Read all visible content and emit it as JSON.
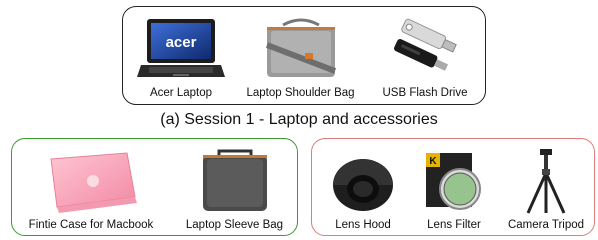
{
  "session1": {
    "caption": "(a) Session 1 - Laptop and accessories",
    "items": [
      {
        "label": "Acer Laptop",
        "logo_text": "acer",
        "icon": "laptop-image"
      },
      {
        "label": "Laptop Shoulder Bag",
        "icon": "shoulder-bag-image"
      },
      {
        "label": "USB Flash Drive",
        "icon": "usb-drive-image"
      }
    ]
  },
  "session2_left": {
    "items": [
      {
        "label": "Fintie Case for Macbook",
        "icon": "macbook-case-image"
      },
      {
        "label": "Laptop Sleeve Bag",
        "icon": "sleeve-bag-image"
      }
    ]
  },
  "session2_right": {
    "items": [
      {
        "label": "Lens Hood",
        "icon": "lens-hood-image"
      },
      {
        "label": "Lens Filter",
        "brand_text": "K",
        "icon": "lens-filter-image"
      },
      {
        "label": "Camera Tripod",
        "icon": "tripod-image"
      }
    ]
  },
  "colors": {
    "session1_border": "#222222",
    "session2_left_border": "#3a9a2e",
    "session2_right_border": "#e07b7b"
  }
}
